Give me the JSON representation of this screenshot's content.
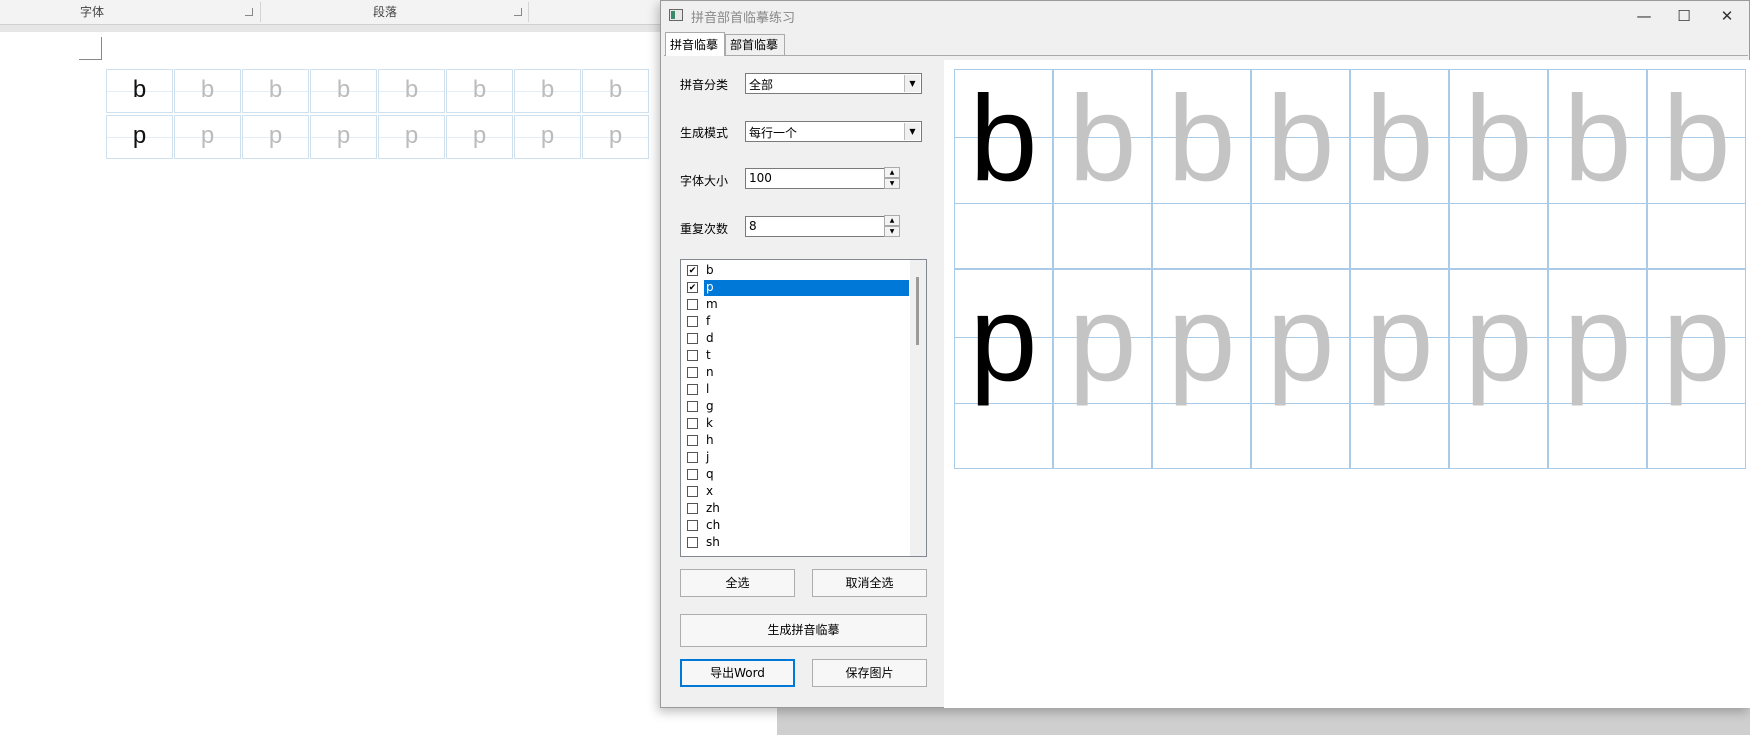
{
  "background_doc": {
    "ribbon_groups": [
      "字体",
      "段落"
    ],
    "rows": [
      {
        "letter": "b",
        "count": 8
      },
      {
        "letter": "p",
        "count": 8
      }
    ]
  },
  "window": {
    "title": "拼音部首临摹练习",
    "controls": {
      "minimize": "—",
      "maximize": "☐",
      "close": "✕"
    }
  },
  "tabs": [
    {
      "label": "拼音临摹",
      "active": true
    },
    {
      "label": "部首临摹",
      "active": false
    }
  ],
  "form": {
    "category_label": "拼音分类",
    "category_value": "全部",
    "mode_label": "生成模式",
    "mode_value": "每行一个",
    "fontsize_label": "字体大小",
    "fontsize_value": "100",
    "repeat_label": "重复次数",
    "repeat_value": "8"
  },
  "pinyin_list": [
    {
      "text": "b",
      "checked": true,
      "selected": false
    },
    {
      "text": "p",
      "checked": true,
      "selected": true
    },
    {
      "text": "m",
      "checked": false,
      "selected": false
    },
    {
      "text": "f",
      "checked": false,
      "selected": false
    },
    {
      "text": "d",
      "checked": false,
      "selected": false
    },
    {
      "text": "t",
      "checked": false,
      "selected": false
    },
    {
      "text": "n",
      "checked": false,
      "selected": false
    },
    {
      "text": "l",
      "checked": false,
      "selected": false
    },
    {
      "text": "g",
      "checked": false,
      "selected": false
    },
    {
      "text": "k",
      "checked": false,
      "selected": false
    },
    {
      "text": "h",
      "checked": false,
      "selected": false
    },
    {
      "text": "j",
      "checked": false,
      "selected": false
    },
    {
      "text": "q",
      "checked": false,
      "selected": false
    },
    {
      "text": "x",
      "checked": false,
      "selected": false
    },
    {
      "text": "zh",
      "checked": false,
      "selected": false
    },
    {
      "text": "ch",
      "checked": false,
      "selected": false
    },
    {
      "text": "sh",
      "checked": false,
      "selected": false
    }
  ],
  "buttons": {
    "select_all": "全选",
    "deselect_all": "取消全选",
    "generate": "生成拼音临摹",
    "export_word": "导出Word",
    "save_image": "保存图片"
  },
  "preview": {
    "rows": [
      {
        "letter": "b",
        "count": 8
      },
      {
        "letter": "p",
        "count": 8
      }
    ]
  },
  "colors": {
    "grid_line": "#a9cbe8",
    "first_letter": "#000000",
    "trace_letter": "#c4c4c4",
    "selection": "#0078d7"
  }
}
